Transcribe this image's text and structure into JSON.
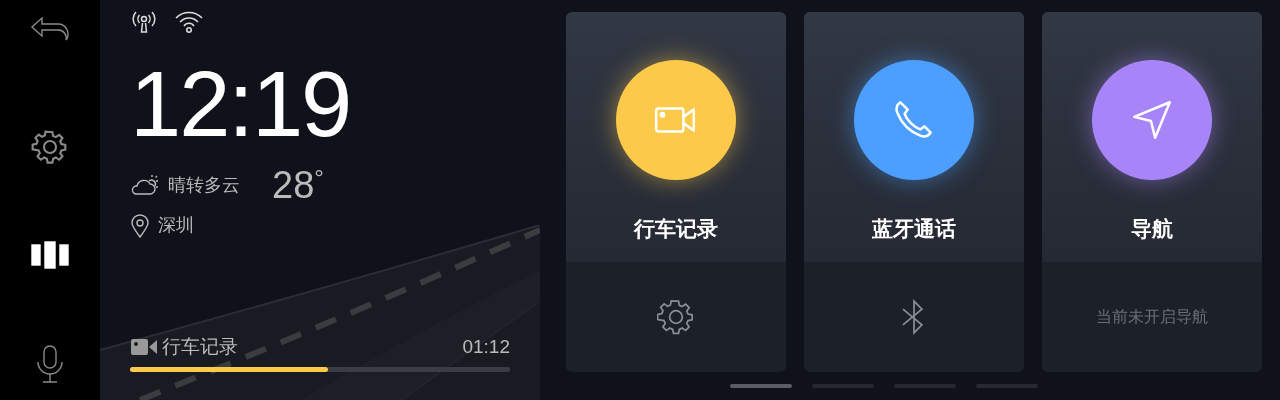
{
  "sidebar": {
    "items": [
      {
        "kind": "back",
        "selected": false
      },
      {
        "kind": "settings",
        "selected": false
      },
      {
        "kind": "home",
        "selected": true
      },
      {
        "kind": "voice",
        "selected": false
      }
    ]
  },
  "clock": {
    "time": "12:19"
  },
  "weather": {
    "condition": "晴转多云",
    "temperature": "28",
    "unit": "°"
  },
  "location": {
    "city": "深圳"
  },
  "recording": {
    "label": "行车记录",
    "time": "01:12",
    "level": 0.52
  },
  "cards": [
    {
      "kind": "recorder",
      "title": "行车记录",
      "color": "#fdc94a"
    },
    {
      "kind": "call",
      "title": "蓝牙通话",
      "color": "#4c9ffe"
    },
    {
      "kind": "navigation",
      "title": "导航",
      "color": "#a784f8",
      "footer_text": "当前未开启导航"
    }
  ],
  "pager": [
    {
      "selected": true
    },
    {
      "selected": false
    },
    {
      "selected": false
    },
    {
      "selected": false
    }
  ]
}
